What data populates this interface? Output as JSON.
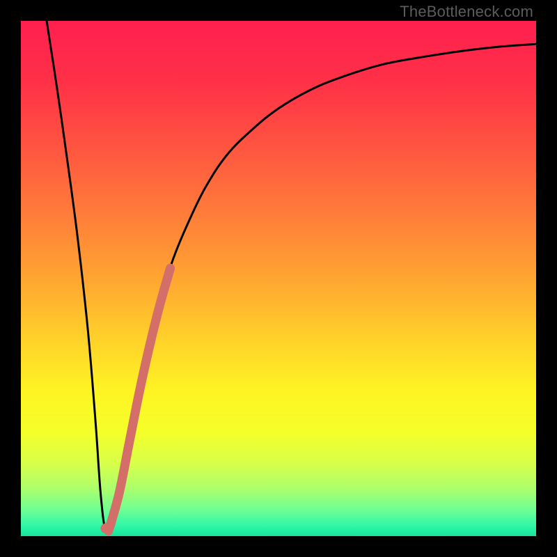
{
  "watermark": "TheBottleneck.com",
  "colors": {
    "frame": "#000000",
    "curve": "#000000",
    "highlight": "#d46e68",
    "gradient_stops": [
      {
        "offset": 0.0,
        "color": "#ff1f4f"
      },
      {
        "offset": 0.12,
        "color": "#ff3147"
      },
      {
        "offset": 0.25,
        "color": "#ff5640"
      },
      {
        "offset": 0.38,
        "color": "#ff7e39"
      },
      {
        "offset": 0.5,
        "color": "#ffa531"
      },
      {
        "offset": 0.62,
        "color": "#ffd22a"
      },
      {
        "offset": 0.72,
        "color": "#fef423"
      },
      {
        "offset": 0.8,
        "color": "#f4ff2a"
      },
      {
        "offset": 0.86,
        "color": "#d7ff4a"
      },
      {
        "offset": 0.91,
        "color": "#a9ff6e"
      },
      {
        "offset": 0.95,
        "color": "#6dff95"
      },
      {
        "offset": 0.98,
        "color": "#30f7a8"
      },
      {
        "offset": 1.0,
        "color": "#17e39a"
      }
    ]
  },
  "chart_data": {
    "type": "line",
    "title": "",
    "xlabel": "",
    "ylabel": "",
    "xlim": [
      0,
      100
    ],
    "ylim": [
      0,
      100
    ],
    "grid": false,
    "series": [
      {
        "name": "bottleneck-curve",
        "x": [
          5,
          7,
          9,
          11,
          13,
          14.5,
          15.5,
          16.5,
          18,
          20,
          22,
          24,
          26,
          28,
          30,
          33,
          36,
          40,
          45,
          50,
          56,
          62,
          70,
          78,
          86,
          93,
          100
        ],
        "y": [
          100,
          87,
          73,
          58,
          40,
          22,
          8,
          1,
          2,
          11,
          22,
          32,
          41,
          49,
          55,
          62,
          68,
          74,
          79,
          83,
          86.5,
          89,
          91.5,
          93,
          94.2,
          95,
          95.5
        ]
      },
      {
        "name": "highlight-segment",
        "x": [
          17,
          19,
          21,
          23,
          25,
          27,
          29
        ],
        "y": [
          1,
          8,
          18,
          28,
          37,
          45,
          52
        ]
      }
    ],
    "annotations": []
  }
}
